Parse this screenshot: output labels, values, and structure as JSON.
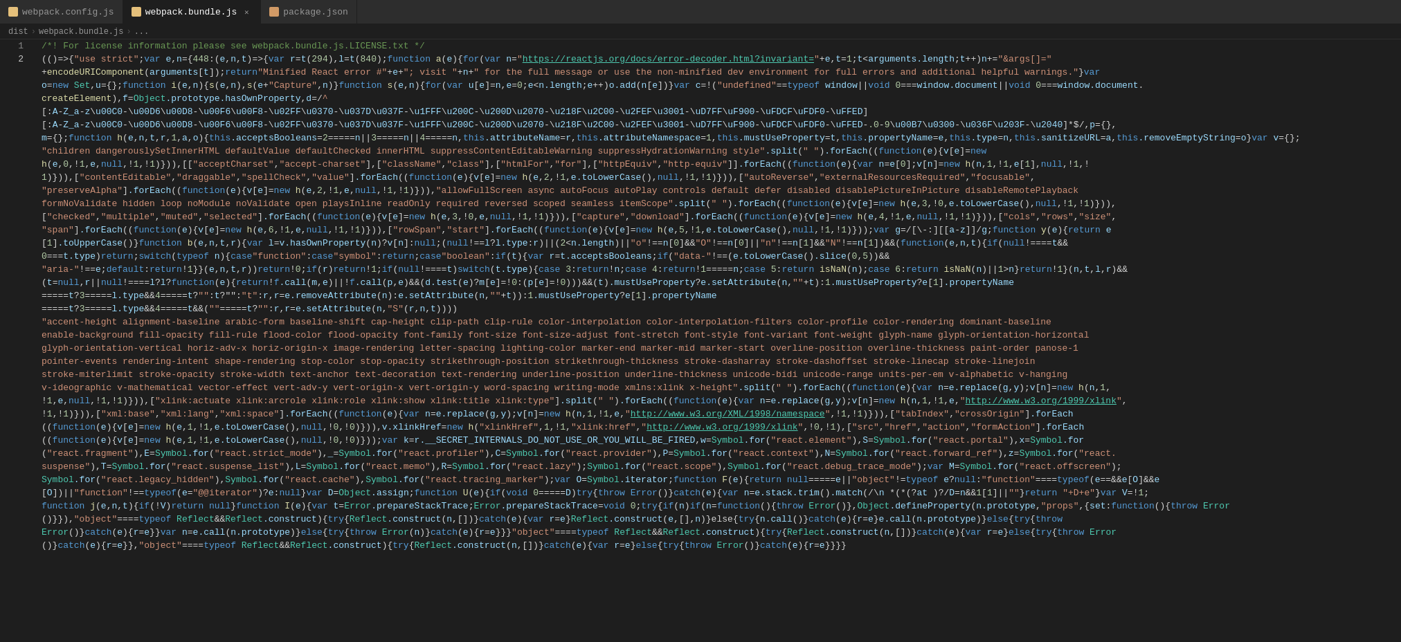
{
  "tabs": [
    {
      "id": "webpack-config",
      "label": "webpack.config.js",
      "icon_color": "yellow",
      "active": false,
      "closeable": false
    },
    {
      "id": "webpack-bundle",
      "label": "webpack.bundle.js",
      "icon_color": "yellow",
      "active": true,
      "closeable": true
    },
    {
      "id": "package-json",
      "label": "package.json",
      "icon_color": "orange",
      "active": false,
      "closeable": false
    }
  ],
  "breadcrumb": {
    "parts": [
      "dist",
      "webpack.bundle.js",
      "..."
    ]
  },
  "line_numbers": [
    "1",
    "2"
  ],
  "colors": {
    "tab_active_bg": "#1e1e1e",
    "tab_inactive_bg": "#2d2d2d",
    "editor_bg": "#1e1e1e",
    "accent": "#569cd6"
  }
}
